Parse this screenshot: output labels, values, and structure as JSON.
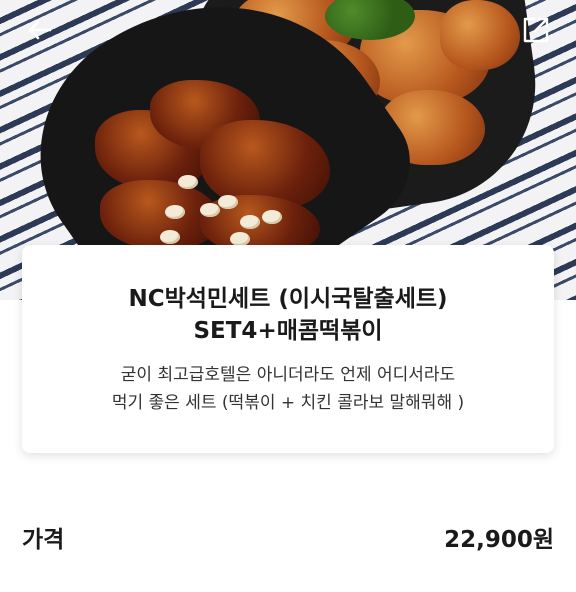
{
  "header": {
    "back_icon": "back-arrow-icon",
    "share_icon": "share-icon"
  },
  "product": {
    "name_line1": "NC박석민세트 (이시국탈출세트)",
    "name_line2": "SET4+매콤떡볶이",
    "description_line1": "굳이 최고급호텔은 아니더라도 언제 어디서라도",
    "description_line2": "먹기 좋은 세트 (떡볶이 + 치킨 콜라보 말해뭐해 )"
  },
  "price": {
    "label": "가격",
    "value": "22,900원"
  }
}
